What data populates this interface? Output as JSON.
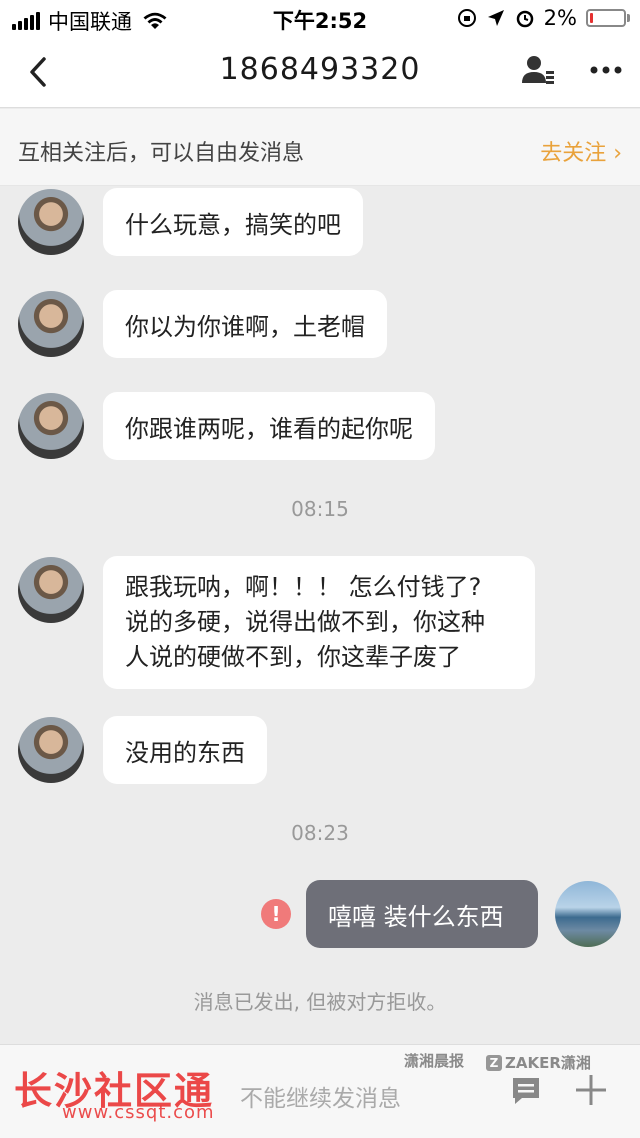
{
  "status_bar": {
    "carrier": "中国联通",
    "time": "下午2:52",
    "battery": "2%",
    "battery_level": 0.02,
    "battery_color": "#e53030"
  },
  "nav": {
    "title": "1868493320",
    "icons": [
      "chevron-left-icon",
      "profile-icon",
      "more-icon"
    ]
  },
  "follow_banner": {
    "text": "互相关注后，可以自由发消息",
    "link": "去关注 ›",
    "link_color": "#e9a23b"
  },
  "messages": [
    {
      "sender": "other",
      "text": "什么玩意，搞笑的吧"
    },
    {
      "sender": "other",
      "text": "你以为你谁啊，土老帽"
    },
    {
      "sender": "other",
      "text": "你跟谁两呢，谁看的起你呢"
    },
    {
      "type": "time",
      "text": "08:15"
    },
    {
      "sender": "other",
      "lines": [
        "跟我玩呐，啊！！！ 怎么付钱了?",
        "说的多硬，说得出做不到，你这种",
        "人说的硬做不到，你这辈子废了"
      ]
    },
    {
      "sender": "other",
      "text": "没用的东西"
    },
    {
      "type": "time",
      "text": "08:23"
    },
    {
      "sender": "me",
      "text": "嘻嘻 装什么东西",
      "status": "failed",
      "error_mark": "!"
    }
  ],
  "rejected_note": "消息已发出, 但被对方拒收。",
  "input_bar": {
    "hint": "不能继续发消息",
    "icons": [
      "chat-input-icon",
      "plus-icon"
    ]
  },
  "watermarks": {
    "main": "长沙社区通",
    "url": "www.cssqt.com",
    "paper": "潇湘晨报",
    "zaker": "ZAKER潇湘",
    "zaker_mark": "Z"
  },
  "colors": {
    "background": "#ececec",
    "bubble_in": "#ffffff",
    "bubble_out": "#6e6f78",
    "error": "#f07a7a"
  }
}
